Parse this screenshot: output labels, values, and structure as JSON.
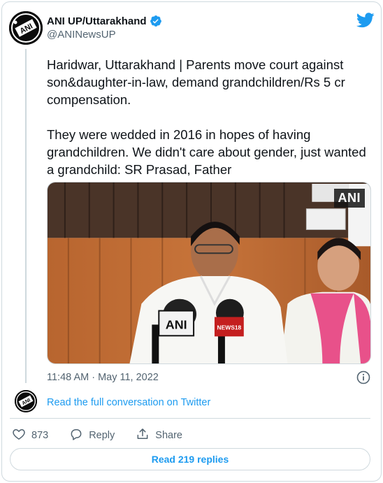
{
  "tweet": {
    "author": {
      "display_name": "ANI UP/Uttarakhand",
      "handle": "@ANINewsUP",
      "verified": true,
      "avatar_text": "ANI"
    },
    "text": [
      "Haridwar, Uttarakhand | Parents move court against son&daughter-in-law, demand grandchildren/Rs 5 cr compensation.",
      "They were wedded in 2016 in hopes of having grandchildren. We didn't care about gender, just wanted a grandchild: SR Prasad, Father"
    ],
    "media": {
      "watermark": "ANI",
      "mic_labels": [
        "ANI",
        "NEWS18"
      ]
    },
    "timestamp": "11:48 AM · May 11, 2022",
    "read_conversation": "Read the full conversation on Twitter",
    "actions": {
      "likes": "873",
      "reply_label": "Reply",
      "share_label": "Share"
    },
    "read_replies": "Read 219 replies"
  },
  "colors": {
    "accent": "#1d9bf0",
    "text_primary": "#0f1419",
    "text_secondary": "#536471",
    "border": "#cfd9de"
  },
  "icons": [
    "verified-badge-icon",
    "twitter-bird-icon",
    "info-icon",
    "heart-icon",
    "reply-icon",
    "share-icon"
  ]
}
